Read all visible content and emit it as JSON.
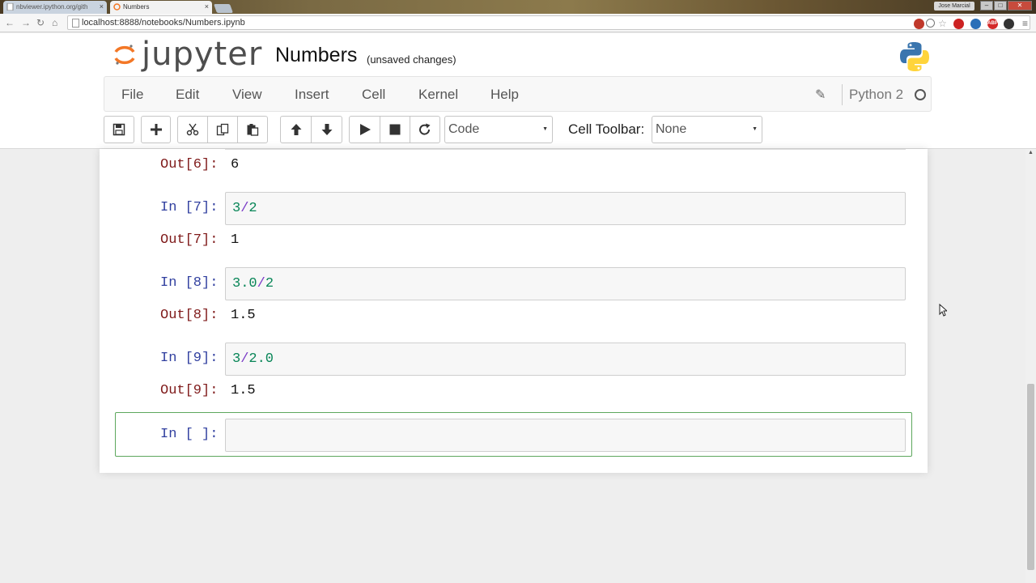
{
  "browser": {
    "tabs": [
      {
        "title": "nbviewer.ipython.org/gith",
        "active": false
      },
      {
        "title": "Numbers",
        "active": true
      }
    ],
    "tab_close_glyph": "×",
    "user_label": "Jose Marcial",
    "window_controls": {
      "minimize": "–",
      "maximize": "□",
      "close": "✕"
    },
    "url": "localhost:8888/notebooks/Numbers.ipynb",
    "extensions": [
      {
        "name": "lastpass-icon",
        "color": "#c0392b",
        "label": ""
      },
      {
        "name": "zoom-icon",
        "color": "#777777",
        "label": ""
      },
      {
        "name": "star-icon",
        "color": "#999999",
        "label": ""
      },
      {
        "name": "opera-icon",
        "color": "#cc2222",
        "label": ""
      },
      {
        "name": "clock-icon",
        "color": "#2a6fb8",
        "label": ""
      },
      {
        "name": "adblock-icon",
        "color": "#d42a2a",
        "label": "ABP"
      },
      {
        "name": "theme-icon",
        "color": "#333333",
        "label": ""
      },
      {
        "name": "menu-icon",
        "color": "#666666",
        "label": ""
      }
    ]
  },
  "header": {
    "logo_text": "jupyter",
    "notebook_name": "Numbers",
    "save_status": "(unsaved changes)"
  },
  "menu": {
    "items": [
      "File",
      "Edit",
      "View",
      "Insert",
      "Cell",
      "Kernel",
      "Help"
    ],
    "kernel_name": "Python 2"
  },
  "toolbar": {
    "cell_type": "Code",
    "cell_toolbar_label": "Cell Toolbar:",
    "cell_toolbar_value": "None"
  },
  "cells": [
    {
      "out_prompt": "Out[6]:",
      "output": "6"
    },
    {
      "in_prompt": "In [7]:",
      "code": [
        {
          "t": "3",
          "k": "num"
        },
        {
          "t": "/",
          "k": "op"
        },
        {
          "t": "2",
          "k": "num"
        }
      ],
      "out_prompt": "Out[7]:",
      "output": "1"
    },
    {
      "in_prompt": "In [8]:",
      "code": [
        {
          "t": "3.0",
          "k": "num"
        },
        {
          "t": "/",
          "k": "op"
        },
        {
          "t": "2",
          "k": "num"
        }
      ],
      "out_prompt": "Out[8]:",
      "output": "1.5"
    },
    {
      "in_prompt": "In [9]:",
      "code": [
        {
          "t": "3",
          "k": "num"
        },
        {
          "t": "/",
          "k": "op"
        },
        {
          "t": "2.0",
          "k": "num"
        }
      ],
      "out_prompt": "Out[9]:",
      "output": "1.5"
    },
    {
      "in_prompt": "In [ ]:",
      "code": []
    }
  ]
}
